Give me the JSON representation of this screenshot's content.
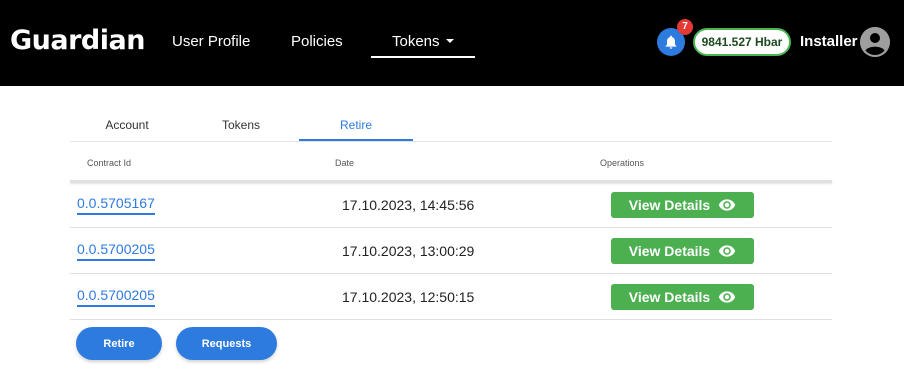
{
  "header": {
    "logo": "Guardian",
    "nav": [
      {
        "label": "User Profile"
      },
      {
        "label": "Policies"
      },
      {
        "label": "Tokens",
        "dropdown": true,
        "active": true
      }
    ],
    "notifications": {
      "count": "7",
      "icon": "bell-icon"
    },
    "balance": "9841.527 Hbar",
    "user": {
      "name": "Installer",
      "icon": "account-circle-icon"
    }
  },
  "tabs": [
    {
      "label": "Account"
    },
    {
      "label": "Tokens"
    },
    {
      "label": "Retire",
      "active": true
    }
  ],
  "table": {
    "columns": [
      "Contract Id",
      "Date",
      "Operations"
    ],
    "rows": [
      {
        "contract_id": "0.0.5705167",
        "date": "17.10.2023, 14:45:56",
        "action": "View Details"
      },
      {
        "contract_id": "0.0.5700205",
        "date": "17.10.2023, 13:00:29",
        "action": "View Details"
      },
      {
        "contract_id": "0.0.5700205",
        "date": "17.10.2023, 12:50:15",
        "action": "View Details"
      }
    ]
  },
  "actions": {
    "retire": "Retire",
    "requests": "Requests"
  },
  "colors": {
    "header_bg": "#000000",
    "accent": "#2e7be0",
    "success": "#4caf50",
    "badge": "#e53935"
  }
}
